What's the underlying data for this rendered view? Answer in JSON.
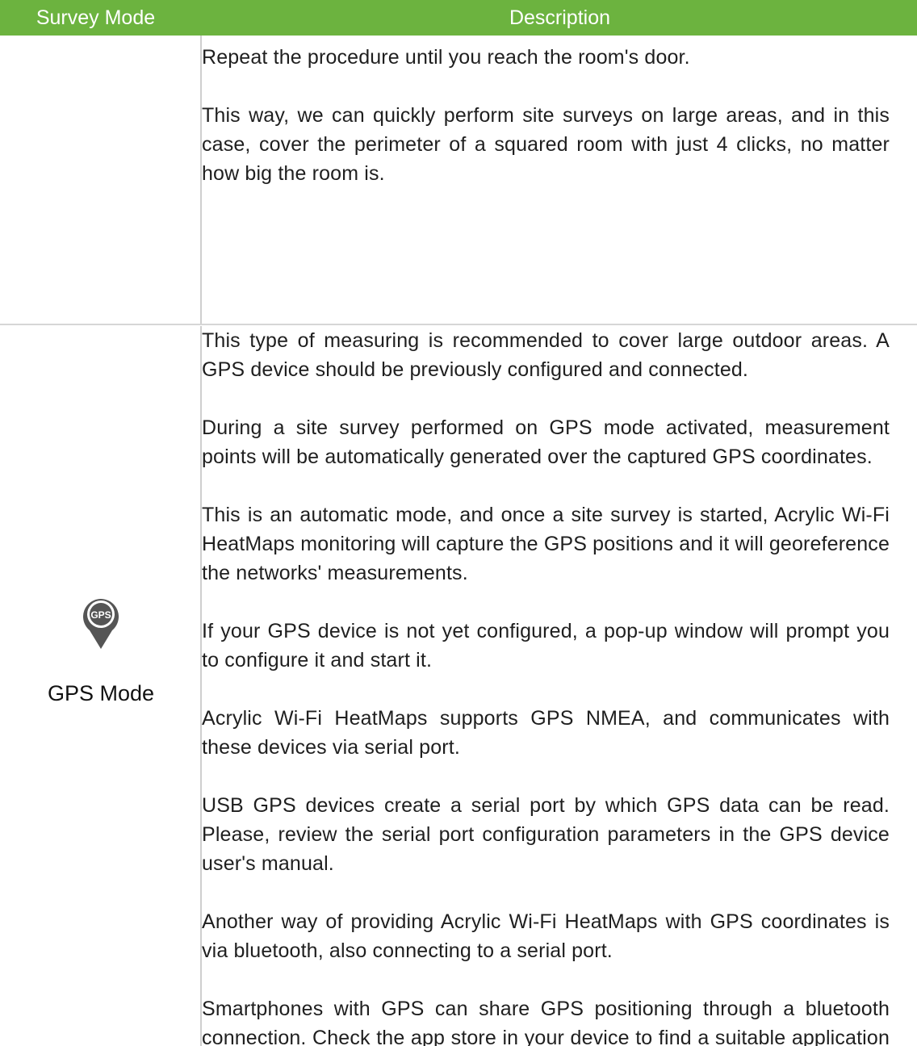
{
  "table": {
    "header": {
      "survey_mode": "Survey Mode",
      "description": "Description",
      "background_color": "#6cb33f",
      "text_color": "#ffffff"
    },
    "rows": [
      {
        "mode_label": "",
        "paragraphs": [
          "Repeat the procedure until you reach the room's door.",
          "This way, we can quickly perform site surveys on large areas, and in this case, cover the perimeter of a squared room with just 4 clicks, no matter how big the room is."
        ]
      },
      {
        "mode_label": "GPS Mode",
        "icon": "gps-pin-icon",
        "icon_text": "GPS",
        "paragraphs": [
          "This type of measuring is recommended to cover large outdoor areas. A GPS device should be previously configured and connected.",
          "During a site survey performed on GPS mode activated, measurement points will be automatically generated over the captured GPS coordinates.",
          "This is an automatic mode, and once a site survey is started, Acrylic Wi-Fi HeatMaps monitoring will capture the GPS positions and it will georeference the networks' measurements.",
          "If your GPS device is not yet configured, a pop-up window will prompt you to configure it and start it.",
          "Acrylic Wi-Fi HeatMaps supports GPS NMEA, and communicates with these devices via serial port.",
          "USB GPS devices create a serial port by which GPS data can be read. Please, review the serial port configuration parameters in the GPS device user's manual.",
          "Another way of providing Acrylic Wi-Fi HeatMaps with GPS coordinates is via bluetooth, also connecting to a serial port.",
          "Smartphones with GPS can share GPS positioning through a bluetooth connection. Check the app store in your device to find a suitable application for this use."
        ]
      }
    ]
  }
}
